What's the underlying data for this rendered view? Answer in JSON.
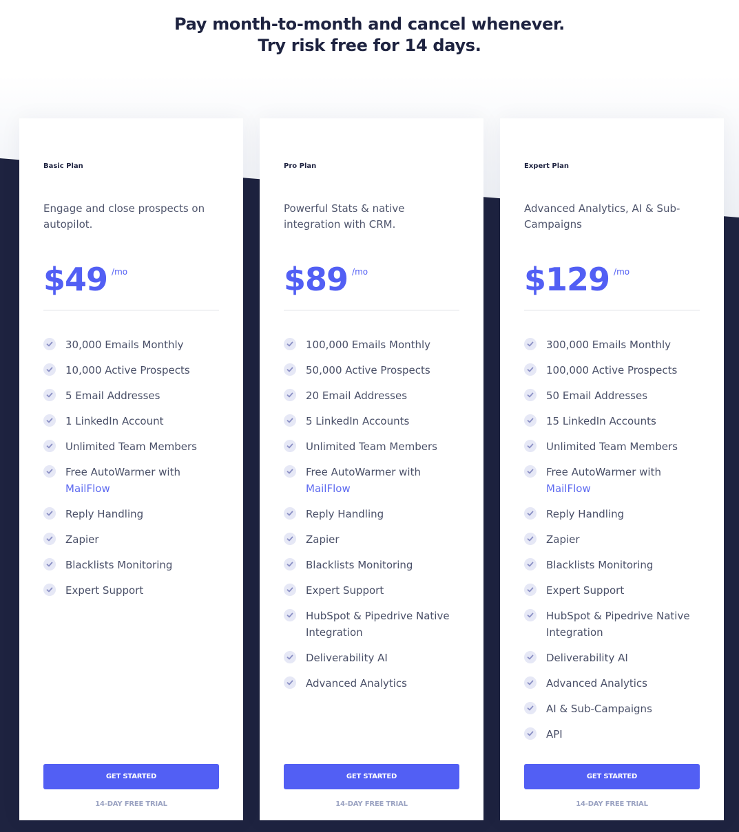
{
  "header": {
    "line1": "Pay month-to-month and cancel whenever.",
    "line2": "Try risk free for 14 days."
  },
  "colors": {
    "accent": "#525ff4",
    "dark_bg": "#1e2340",
    "check_bg": "#e6e8f6",
    "check_mark": "#8a8fc4",
    "link": "#5d6af0",
    "trial_text": "#9ba3c2"
  },
  "plans": [
    {
      "name": "Basic Plan",
      "description": "Engage and close prospects on autopilot.",
      "price": "$49",
      "price_unit": "/mo",
      "features": [
        {
          "text": "30,000 Emails Monthly"
        },
        {
          "text": "10,000 Active Prospects"
        },
        {
          "text": "5 Email Addresses"
        },
        {
          "text": "1 LinkedIn Account"
        },
        {
          "text": "Unlimited Team Members"
        },
        {
          "text": "Free AutoWarmer with",
          "link": "MailFlow"
        },
        {
          "text": "Reply Handling"
        },
        {
          "text": "Zapier"
        },
        {
          "text": "Blacklists Monitoring"
        },
        {
          "text": "Expert Support"
        }
      ],
      "cta_label": "GET STARTED",
      "trial_label": "14-DAY FREE TRIAL"
    },
    {
      "name": "Pro Plan",
      "description": "Powerful Stats & native integration with CRM.",
      "price": "$89",
      "price_unit": "/mo",
      "features": [
        {
          "text": "100,000 Emails Monthly"
        },
        {
          "text": "50,000 Active Prospects"
        },
        {
          "text": "20 Email Addresses"
        },
        {
          "text": "5 LinkedIn Accounts"
        },
        {
          "text": "Unlimited Team Members"
        },
        {
          "text": "Free AutoWarmer with",
          "link": "MailFlow"
        },
        {
          "text": "Reply Handling"
        },
        {
          "text": "Zapier"
        },
        {
          "text": "Blacklists Monitoring"
        },
        {
          "text": "Expert Support"
        },
        {
          "text": "HubSpot & Pipedrive Native Integration"
        },
        {
          "text": "Deliverability AI"
        },
        {
          "text": "Advanced Analytics"
        }
      ],
      "cta_label": "GET STARTED",
      "trial_label": "14-DAY FREE TRIAL"
    },
    {
      "name": "Expert Plan",
      "description": "Advanced Analytics, AI & Sub-Campaigns",
      "price": "$129",
      "price_unit": "/mo",
      "features": [
        {
          "text": "300,000 Emails Monthly"
        },
        {
          "text": "100,000 Active Prospects"
        },
        {
          "text": "50 Email Addresses"
        },
        {
          "text": "15 LinkedIn Accounts"
        },
        {
          "text": "Unlimited Team Members"
        },
        {
          "text": "Free AutoWarmer with",
          "link": "MailFlow"
        },
        {
          "text": "Reply Handling"
        },
        {
          "text": "Zapier"
        },
        {
          "text": "Blacklists Monitoring"
        },
        {
          "text": "Expert Support"
        },
        {
          "text": "HubSpot & Pipedrive Native Integration"
        },
        {
          "text": "Deliverability AI"
        },
        {
          "text": "Advanced Analytics"
        },
        {
          "text": "AI & Sub-Campaigns"
        },
        {
          "text": "API"
        }
      ],
      "cta_label": "GET STARTED",
      "trial_label": "14-DAY FREE TRIAL"
    }
  ]
}
